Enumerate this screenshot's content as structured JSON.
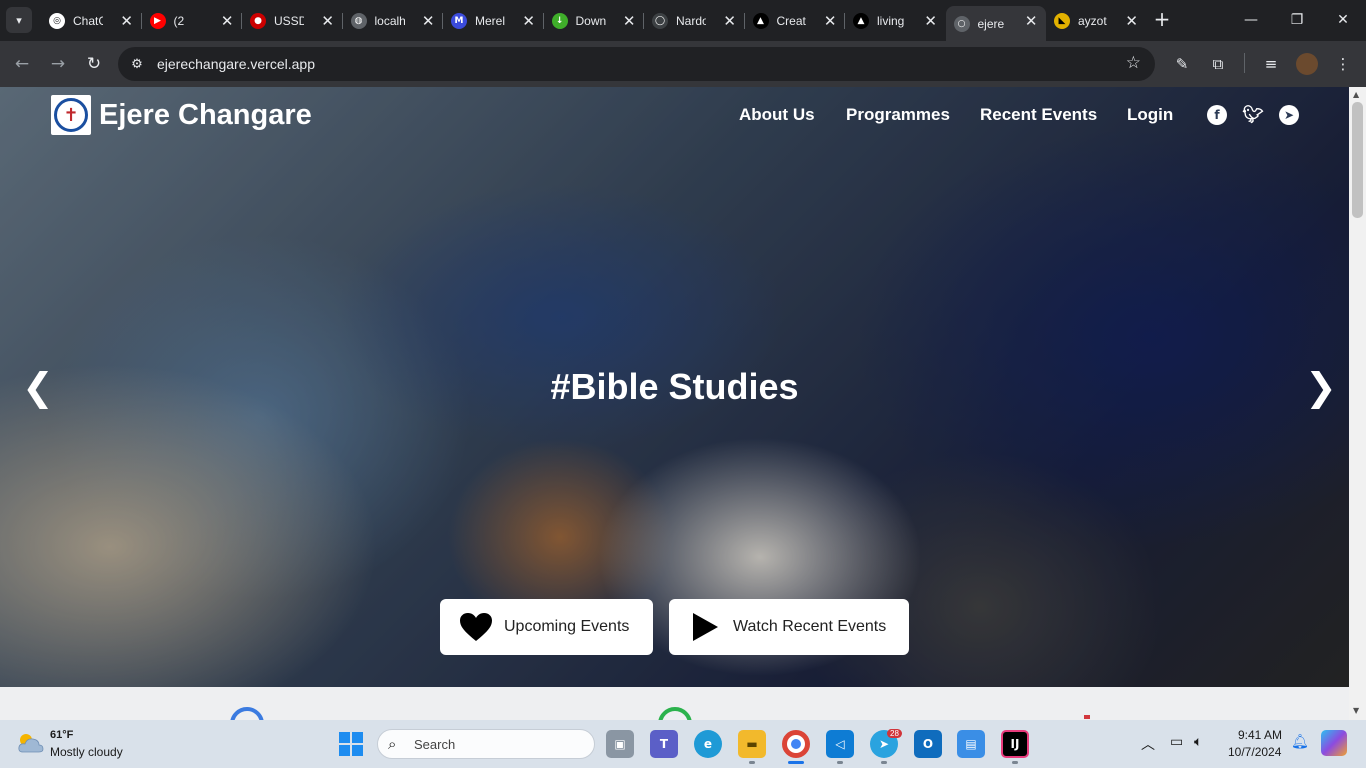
{
  "browser": {
    "tabs": [
      {
        "title": "ChatGPT",
        "icon": "chatgpt-icon",
        "color": "#ffffff",
        "text_color": "#202124",
        "glyph": "◎"
      },
      {
        "title": "(2",
        "icon": "youtube-icon",
        "color": "#ff0000",
        "text_color": "#ffffff",
        "glyph": "▶"
      },
      {
        "title": "USSD",
        "icon": "redhat-icon",
        "color": "#cc0000",
        "text_color": "#ffffff",
        "glyph": "●"
      },
      {
        "title": "localh",
        "icon": "globe-icon",
        "color": "#5f6368",
        "text_color": "#ffffff",
        "glyph": "◍"
      },
      {
        "title": "Merel",
        "icon": "merel-icon",
        "color": "#3b4bdb",
        "text_color": "#ffffff",
        "glyph": "M"
      },
      {
        "title": "Down",
        "icon": "download-icon",
        "color": "#3fae2a",
        "text_color": "#ffffff",
        "glyph": "↓"
      },
      {
        "title": "Nardo",
        "icon": "github-icon",
        "color": "#3c4043",
        "text_color": "#ffffff",
        "glyph": "◯"
      },
      {
        "title": "Creat",
        "icon": "vercel-icon",
        "color": "#000000",
        "text_color": "#ffffff",
        "glyph": "▲"
      },
      {
        "title": "living",
        "icon": "vercel-icon",
        "color": "#000000",
        "text_color": "#ffffff",
        "glyph": "▲"
      },
      {
        "title": "ejere",
        "icon": "loading-icon",
        "color": "#5f6368",
        "text_color": "#ffffff",
        "glyph": "○"
      },
      {
        "title": "ayzot",
        "icon": "ayzot-icon",
        "color": "#e2b100",
        "text_color": "#000000",
        "glyph": "◣"
      }
    ],
    "tab_close_glyph": "✕",
    "active_tab_index": 9,
    "url": "ejerechangare.vercel.app"
  },
  "page": {
    "brand": "Ejere Changare",
    "nav": [
      {
        "label": "About Us"
      },
      {
        "label": "Programmes"
      },
      {
        "label": "Recent Events"
      },
      {
        "label": "Login"
      }
    ],
    "slide_title": "#Bible Studies",
    "prev_arrow": "❮",
    "next_arrow": "❯",
    "buttons": [
      {
        "label": "Upcoming Events",
        "icon": "heart-icon"
      },
      {
        "label": "Watch Recent Events",
        "icon": "play-icon"
      }
    ]
  },
  "taskbar": {
    "weather_temp": "61°F",
    "weather_desc": "Mostly cloudy",
    "search_placeholder": "Search",
    "telegram_badge": "28",
    "time": "9:41 AM",
    "date": "10/7/2024"
  },
  "colors": {
    "chrome_dark": "#202124",
    "toolbar": "#35363a",
    "taskbar": "#d9e1ea",
    "accent": "#1a73e8"
  }
}
